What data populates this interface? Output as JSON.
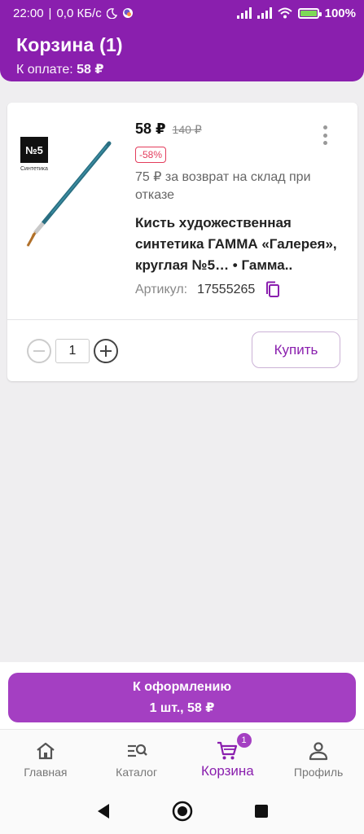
{
  "status_bar": {
    "time": "22:00",
    "net_speed": "0,0 КБ/с",
    "battery_percent": "100%"
  },
  "header": {
    "title": "Корзина (1)",
    "pay_label": "К оплате:",
    "pay_amount": "58 ₽"
  },
  "product": {
    "badge_text": "№5",
    "badge_caption": "Синтетика",
    "price": "58 ₽",
    "old_price": "140 ₽",
    "discount": "-58%",
    "refund_note": "75 ₽ за возврат на склад при отказе",
    "name": "Кисть художественная синтетика ГАММА «Галерея», круглая №5… • Гамма..",
    "sku_label": "Артикул:",
    "sku_value": "17555265",
    "quantity": "1",
    "buy_label": "Купить"
  },
  "checkout": {
    "label": "К оформлению",
    "summary": "1 шт., 58 ₽"
  },
  "nav": {
    "items": [
      {
        "label": "Главная",
        "icon": "home-icon"
      },
      {
        "label": "Каталог",
        "icon": "catalog-search-icon"
      },
      {
        "label": "Корзина",
        "icon": "cart-icon",
        "badge": "1",
        "active": true
      },
      {
        "label": "Профиль",
        "icon": "profile-icon"
      }
    ]
  },
  "colors": {
    "brand": "#8a1fae",
    "checkout": "#a43fc2",
    "discount": "#e33c5c"
  }
}
